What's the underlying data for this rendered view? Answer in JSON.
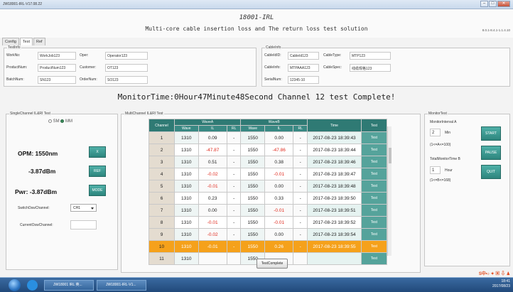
{
  "window": {
    "title": "JW18001-IRL-V17.08.22"
  },
  "header": {
    "app_name": "18001-IRL",
    "subtitle": "Multi-core cable insertion loss and The return loss test solution",
    "version": "8.0.1-8.4.1-1.1.4.10"
  },
  "tabs": [
    {
      "label": "Config"
    },
    {
      "label": "Test"
    },
    {
      "label": "Ref"
    }
  ],
  "test_info": {
    "legend": "TestInfo",
    "work_no_label": "WorkNo:",
    "work_no": "WorkJob123",
    "oper_label": "Oper:",
    "oper": "Operator123",
    "product_num_label": "ProductNum:",
    "product_num": "ProductNum123",
    "customer_label": "Customer:",
    "customer": "OT123",
    "batch_num_label": "BatchNum:",
    "batch_num": "SN123",
    "order_num_label": "OrderNum:",
    "order_num": "SO123"
  },
  "cable_info": {
    "legend": "CableInfo",
    "cable_id_label": "CableIdID:",
    "cable_id": "CableId123",
    "cable_type_label": "CableType:",
    "cable_type": "MTP123",
    "cable_info_label": "CableInfo:",
    "cable_info": "MTPAAA123",
    "cable_spec_label": "CableSpec:",
    "cable_spec": "线缆规格123",
    "serial_num_label": "SerialNum:",
    "serial_num": "12345-10"
  },
  "monitor_time": "MonitorTime:0Hour47Minute48Second  Channel 12 test Complete!",
  "single_channel": {
    "legend": "SingleChannel IL&RI Test",
    "sm_label": "SM",
    "mm_label": "MM",
    "opm": "OPM:  1550nm",
    "dbm": "-3.87dBm",
    "pwr": "Pwr:  -3.87dBm",
    "btn_x": "X",
    "btn_ref": "REF",
    "btn_mode": "MODE",
    "switch_label": "SwitchOswChannel:",
    "switch_value": "CH1",
    "current_label": "CurrentOswChannel:"
  },
  "multi_channel": {
    "legend": "MultiChannel IL&RI Test",
    "headers": {
      "channel": "Channel",
      "group1": "WaveA",
      "group2": "WaveB",
      "time": "Time",
      "test": "Test",
      "wave": "Wave",
      "il": "IL",
      "rl": "RL"
    },
    "rows": [
      {
        "ch": "1",
        "w1": "1310",
        "il1": "0.09",
        "rl1": "-",
        "w2": "1550",
        "il2": "0.00",
        "rl2": "-",
        "time": "2017-08-23 18:39:43",
        "test": "Test"
      },
      {
        "ch": "2",
        "w1": "1310",
        "il1": "-47.87",
        "rl1": "-",
        "w2": "1550",
        "il2": "-47.86",
        "rl2": "-",
        "time": "2017-08-23 18:39:44",
        "test": "Test"
      },
      {
        "ch": "3",
        "w1": "1310",
        "il1": "0.51",
        "rl1": "-",
        "w2": "1550",
        "il2": "0.38",
        "rl2": "-",
        "time": "2017-08-23 18:39:46",
        "test": "Test"
      },
      {
        "ch": "4",
        "w1": "1310",
        "il1": "-0.02",
        "rl1": "-",
        "w2": "1550",
        "il2": "-0.01",
        "rl2": "-",
        "time": "2017-08-23 18:39:47",
        "test": "Test"
      },
      {
        "ch": "5",
        "w1": "1310",
        "il1": "-0.01",
        "rl1": "-",
        "w2": "1550",
        "il2": "0.00",
        "rl2": "-",
        "time": "2017-08-23 18:39:48",
        "test": "Test"
      },
      {
        "ch": "6",
        "w1": "1310",
        "il1": "0.23",
        "rl1": "-",
        "w2": "1550",
        "il2": "0.33",
        "rl2": "-",
        "time": "2017-08-23 18:39:50",
        "test": "Test"
      },
      {
        "ch": "7",
        "w1": "1310",
        "il1": "0.00",
        "rl1": "-",
        "w2": "1550",
        "il2": "-0.01",
        "rl2": "-",
        "time": "2017-08-23 18:39:51",
        "test": "Test"
      },
      {
        "ch": "8",
        "w1": "1310",
        "il1": "-0.01",
        "rl1": "-",
        "w2": "1550",
        "il2": "-0.01",
        "rl2": "-",
        "time": "2017-08-23 18:39:52",
        "test": "Test"
      },
      {
        "ch": "9",
        "w1": "1310",
        "il1": "-0.02",
        "rl1": "-",
        "w2": "1550",
        "il2": "0.00",
        "rl2": "-",
        "time": "2017-08-23 18:39:54",
        "test": "Test"
      },
      {
        "ch": "10",
        "w1": "1310",
        "il1": "-0.01",
        "rl1": "-",
        "w2": "1550",
        "il2": "0.26",
        "rl2": "-",
        "time": "2017-08-23 18:39:55",
        "test": "Test"
      },
      {
        "ch": "11",
        "w1": "1310",
        "il1": "",
        "rl1": "",
        "w2": "1550",
        "il2": "",
        "rl2": "",
        "time": "",
        "test": "Test"
      }
    ],
    "complete_button": "TestComplete"
  },
  "monitor_test": {
    "legend": "MonitorTest",
    "interval_label": "MonitorInterval A",
    "interval_value": "2",
    "interval_unit": "Min",
    "interval_range": "(1<=A<=100)",
    "total_label": "TotalMonitorTime B",
    "total_value": "1",
    "total_unit": "Hour",
    "total_range": "(1<=B<=168)",
    "start": "START",
    "pause": "PAUSE",
    "quit": "QUIT"
  },
  "taskbar": {
    "item1": "JW18001 IRL 英...",
    "item2": "JW18001-IRL-V1...",
    "clock": "18:41",
    "date": "2017/08/23"
  }
}
